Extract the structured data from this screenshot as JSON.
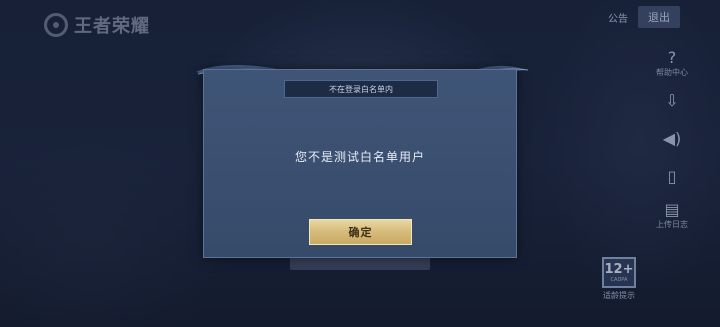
{
  "app": {
    "logo_text": "王者荣耀"
  },
  "top_bar": {
    "notice_label": "公告",
    "logout_label": "退出"
  },
  "sidebar": {
    "items": [
      {
        "icon": "question-icon",
        "glyph": "?",
        "label": "帮助中心"
      },
      {
        "icon": "download-icon",
        "glyph": "⇩",
        "label": ""
      },
      {
        "icon": "speaker-icon",
        "glyph": "◀)",
        "label": ""
      },
      {
        "icon": "phone-icon",
        "glyph": "▯",
        "label": ""
      },
      {
        "icon": "log-upload-icon",
        "glyph": "▤",
        "label": "上传日志"
      }
    ]
  },
  "age_rating": {
    "number": "12+",
    "sub": "CADPA",
    "label": "适龄提示"
  },
  "dialog": {
    "title": "不在登录白名单内",
    "message": "您不是测试白名单用户",
    "confirm_label": "确定"
  },
  "colors": {
    "dialog_bg": "#3b5071",
    "confirm_gold": "#d7bd7d",
    "title_bar": "#1e2b44"
  }
}
